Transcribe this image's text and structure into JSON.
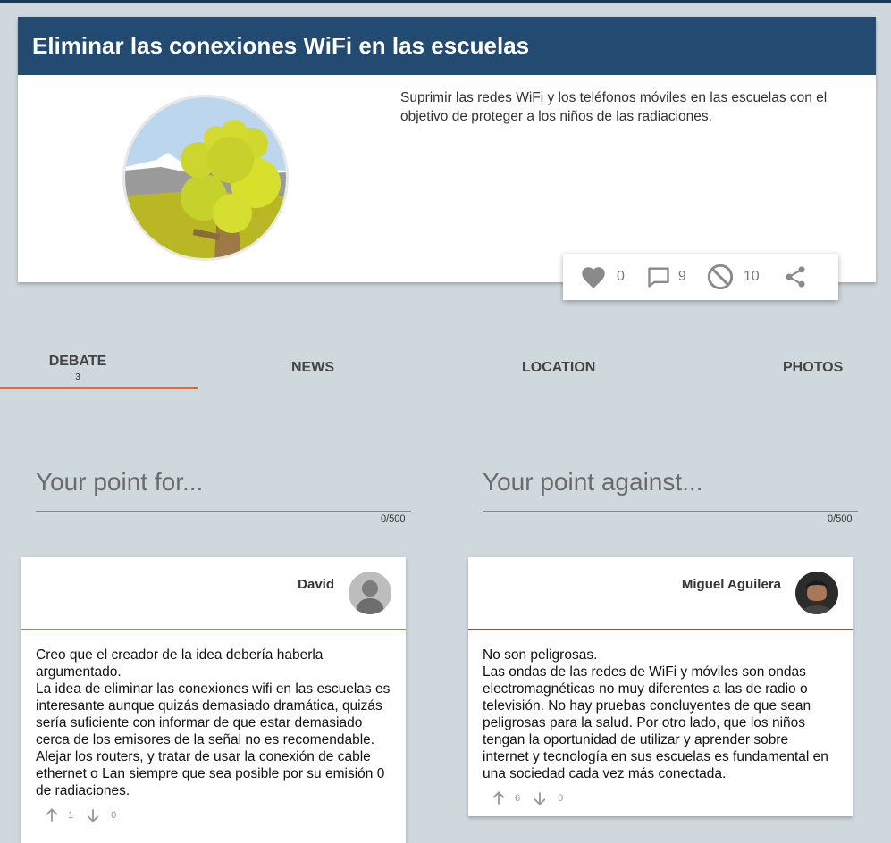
{
  "idea": {
    "title": "Eliminar las conexiones WiFi en las escuelas",
    "description": "Suprimir las redes WiFi y los teléfonos móviles en las escuelas con el objetivo de proteger a los niños de las radiaciones."
  },
  "stats": {
    "likes": "0",
    "comments": "9",
    "rejects": "10"
  },
  "tabs": [
    {
      "label": "DEBATE",
      "count": "3"
    },
    {
      "label": "NEWS"
    },
    {
      "label": "LOCATION"
    },
    {
      "label": "PHOTOS"
    }
  ],
  "point_for": {
    "placeholder": "Your point for...",
    "counter": "0/500"
  },
  "point_against": {
    "placeholder": "Your point against...",
    "counter": "0/500"
  },
  "arguments": [
    {
      "author": "David",
      "text": "Creo que el creador de la idea debería haberla argumentado.\nLa idea de eliminar las conexiones wifi en las escuelas es interesante aunque quizás demasiado dramática, quizás sería suficiente con informar de que estar demasiado cerca de los emisores de la señal no es recomendable. Alejar los routers, y tratar de usar la conexión de cable ethernet o Lan siempre que sea posible por su emisión 0 de radiaciones.",
      "upvotes": "1",
      "downvotes": "0",
      "stance_color": "#6aa84f"
    },
    {
      "author": "Miguel Aguilera",
      "text": "No son peligrosas.\nLas ondas de las redes de WiFi y móviles son ondas electromagnéticas no muy diferentes a las de radio o televisión. No hay pruebas concluyentes de que sean peligrosas para la salud.  Por otro lado, que los niños tengan la oportunidad de utilizar y aprender sobre internet y tecnología en sus escuelas es fundamental en una sociedad cada vez más conectada.",
      "upvotes": "6",
      "downvotes": "0",
      "stance_color": "#b04a4a"
    }
  ],
  "colors": {
    "header": "#234a70",
    "background": "#cfd8dc",
    "tab_accent": "#f26522"
  }
}
